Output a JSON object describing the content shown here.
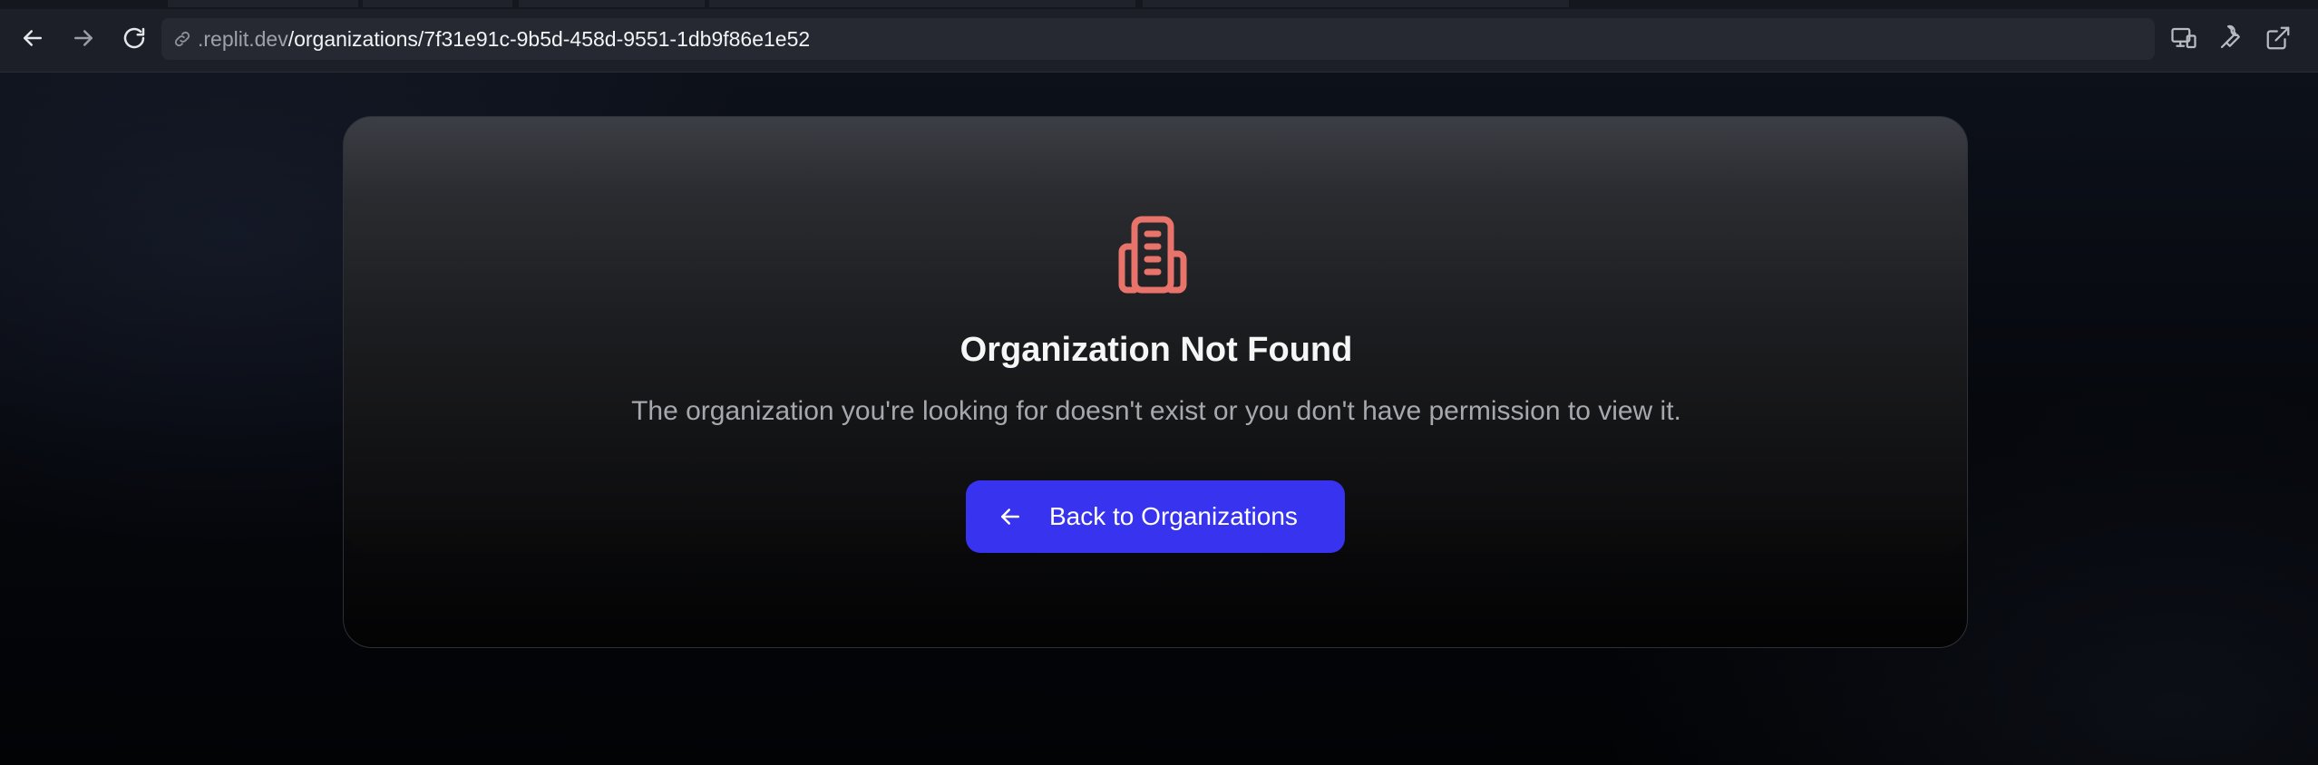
{
  "browser": {
    "url_domain": ".replit.dev",
    "url_path": "/organizations/7f31e91c-9b5d-458d-9551-1db9f86e1e52",
    "icons": [
      "back-arrow-icon",
      "forward-arrow-icon",
      "reload-icon",
      "link-icon",
      "devices-icon",
      "wrench-icon",
      "open-external-icon"
    ]
  },
  "page": {
    "title": "Organization Not Found",
    "description": "The organization you're looking for doesn't exist or you don't have permission to view it.",
    "back_button_label": "Back to Organizations",
    "icon": "building-icon"
  },
  "colors": {
    "accent_button": "#3733ee",
    "icon_red": "#e8736b",
    "title_text": "#f6f6f7",
    "description_text": "#a7a8ae"
  }
}
